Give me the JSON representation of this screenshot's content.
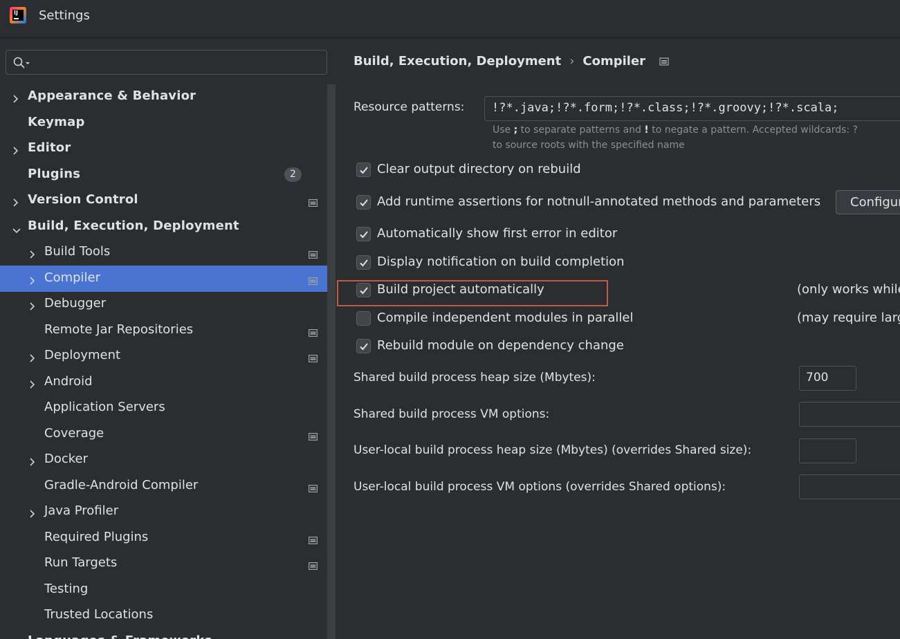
{
  "window": {
    "title": "Settings",
    "logo_text": "IJ"
  },
  "search": {
    "value": "",
    "placeholder": ""
  },
  "tree": [
    {
      "label": "Appearance & Behavior",
      "level": 0,
      "expandable": true,
      "expanded": false
    },
    {
      "label": "Keymap",
      "level": 0,
      "expandable": false
    },
    {
      "label": "Editor",
      "level": 0,
      "expandable": true,
      "expanded": false
    },
    {
      "label": "Plugins",
      "level": 0,
      "expandable": false,
      "badge": "2"
    },
    {
      "label": "Version Control",
      "level": 0,
      "expandable": true,
      "expanded": false,
      "project_icon": true
    },
    {
      "label": "Build, Execution, Deployment",
      "level": 0,
      "expandable": true,
      "expanded": true
    },
    {
      "label": "Build Tools",
      "level": 1,
      "expandable": true,
      "project_icon": true
    },
    {
      "label": "Compiler",
      "level": 1,
      "expandable": true,
      "project_icon": true,
      "selected": true
    },
    {
      "label": "Debugger",
      "level": 1,
      "expandable": true
    },
    {
      "label": "Remote Jar Repositories",
      "level": 1,
      "expandable": false,
      "project_icon": true
    },
    {
      "label": "Deployment",
      "level": 1,
      "expandable": true,
      "project_icon": true
    },
    {
      "label": "Android",
      "level": 1,
      "expandable": true
    },
    {
      "label": "Application Servers",
      "level": 1,
      "expandable": false
    },
    {
      "label": "Coverage",
      "level": 1,
      "expandable": false,
      "project_icon": true
    },
    {
      "label": "Docker",
      "level": 1,
      "expandable": true
    },
    {
      "label": "Gradle-Android Compiler",
      "level": 1,
      "expandable": false,
      "project_icon": true
    },
    {
      "label": "Java Profiler",
      "level": 1,
      "expandable": true
    },
    {
      "label": "Required Plugins",
      "level": 1,
      "expandable": false,
      "project_icon": true
    },
    {
      "label": "Run Targets",
      "level": 1,
      "expandable": false,
      "project_icon": true
    },
    {
      "label": "Testing",
      "level": 1,
      "expandable": false
    },
    {
      "label": "Trusted Locations",
      "level": 1,
      "expandable": false
    },
    {
      "label": "Languages & Frameworks",
      "level": 0,
      "expandable": true,
      "expanded": false
    }
  ],
  "breadcrumb": {
    "parent": "Build, Execution, Deployment",
    "separator": "›",
    "current": "Compiler"
  },
  "compiler": {
    "resource_patterns_label": "Resource patterns:",
    "resource_patterns_value": "!?*.java;!?*.form;!?*.class;!?*.groovy;!?*.scala;",
    "hint_line1_use": "Use",
    "hint_line1_semicolon": ";",
    "hint_line1_mid": "to separate patterns and",
    "hint_line1_bang": "!",
    "hint_line1_end": "to negate a pattern. Accepted wildcards: ?",
    "hint_line2": "to source roots with the specified name",
    "options": [
      {
        "label": "Clear output directory on rebuild",
        "checked": true
      },
      {
        "label": "Add runtime assertions for notnull-annotated methods and parameters",
        "checked": true
      },
      {
        "label": "Automatically show first error in editor",
        "checked": true
      },
      {
        "label": "Display notification on build completion",
        "checked": true
      },
      {
        "label": "Build project automatically",
        "checked": true,
        "highlighted": true
      },
      {
        "label": "Compile independent modules in parallel",
        "checked": false
      },
      {
        "label": "Rebuild module on dependency change",
        "checked": true
      }
    ],
    "configure_button": "Configure annotations...",
    "note_build_auto": "(only works while not running / debugging)",
    "note_parallel": "(may require larger heap size)",
    "shared_heap_label": "Shared build process heap size (Mbytes):",
    "shared_heap_value": "700",
    "shared_vm_label": "Shared build process VM options:",
    "shared_vm_value": "",
    "user_heap_label": "User-local build process heap size (Mbytes) (overrides Shared size):",
    "user_heap_value": "",
    "user_vm_label": "User-local build process VM options (overrides Shared options):",
    "user_vm_value": ""
  },
  "colors": {
    "background": "#2b2d30",
    "selection": "#4a74d2",
    "highlight_border": "#c4584a",
    "text": "#dfe1e5",
    "hint_text": "#8c8f96"
  }
}
